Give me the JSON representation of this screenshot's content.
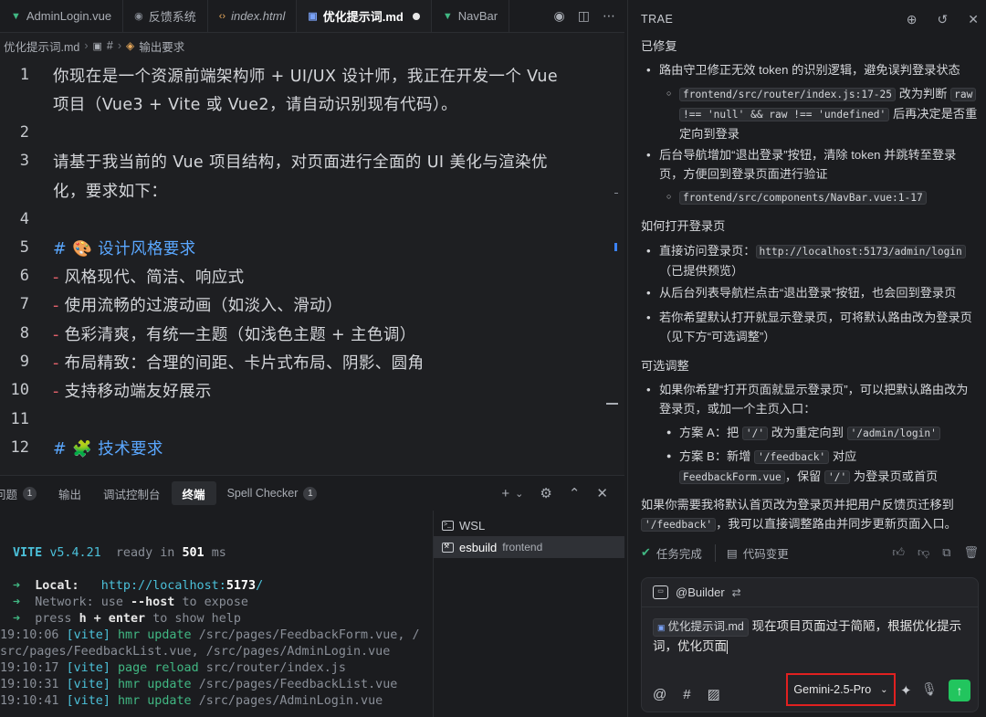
{
  "tabs": [
    {
      "label": "AdminLogin.vue",
      "icon": "vue-icon"
    },
    {
      "label": "反馈系统",
      "icon": "eye-icon"
    },
    {
      "label": "index.html",
      "icon": "html-icon"
    },
    {
      "label": "优化提示词.md",
      "icon": "markdown-icon",
      "active": true,
      "modified": true
    },
    {
      "label": "NavBar",
      "icon": "vue-icon"
    }
  ],
  "breadcrumb": [
    "优化提示词.md",
    "#",
    "输出要求"
  ],
  "editor": {
    "lines": [
      {
        "n": "1",
        "text": "你现在是一个资源前端架构师 + UI/UX 设计师，我正在开发一个 Vue"
      },
      {
        "n": "",
        "text": "项目（Vue3 + Vite 或 Vue2，请自动识别现有代码）。"
      },
      {
        "n": "2",
        "text": ""
      },
      {
        "n": "3",
        "text": "请基于我当前的 Vue 项目结构，对页面进行全面的 UI 美化与渲染优"
      },
      {
        "n": "",
        "text": "化，要求如下："
      },
      {
        "n": "4",
        "text": ""
      },
      {
        "n": "5",
        "text": "# 🎨 设计风格要求"
      },
      {
        "n": "6",
        "text": "- 风格现代、简洁、响应式"
      },
      {
        "n": "7",
        "text": "- 使用流畅的过渡动画（如淡入、滑动）"
      },
      {
        "n": "8",
        "text": "- 色彩清爽，有统一主题（如浅色主题 + 主色调）"
      },
      {
        "n": "9",
        "text": "- 布局精致：合理的间距、卡片式布局、阴影、圆角"
      },
      {
        "n": "10",
        "text": "- 支持移动端友好展示"
      },
      {
        "n": "11",
        "text": ""
      },
      {
        "n": "12",
        "text": "# 🧩 技术要求"
      }
    ]
  },
  "panel": {
    "tabs": [
      {
        "label": "问题",
        "badge": "1"
      },
      {
        "label": "输出"
      },
      {
        "label": "调试控制台"
      },
      {
        "label": "终端",
        "active": true
      },
      {
        "label": "Spell Checker",
        "badge": "1"
      }
    ],
    "terminal_lines": [
      "VITE v5.4.21  ready in 501 ms",
      "➜  Local:   http://localhost:5173/",
      "➜  Network: use --host to expose",
      "➜  press h + enter to show help",
      "19:10:06 [vite] hmr update /src/pages/FeedbackForm.vue, /",
      "src/pages/FeedbackList.vue, /src/pages/AdminLogin.vue",
      "19:10:17 [vite] page reload src/router/index.js",
      "19:10:31 [vite] hmr update /src/pages/FeedbackList.vue",
      "19:10:41 [vite] hmr update /src/pages/AdminLogin.vue"
    ],
    "terminal_parts": {
      "vite": "VITE",
      "version": "v5.4.21",
      "ready": "ready in",
      "ms_val": "501",
      "ms": "ms",
      "arrow": "➜",
      "local_label": "Local:",
      "local_url_a": "http://localhost:",
      "local_port": "5173",
      "local_url_b": "/",
      "network_label": "Network:",
      "network_text_a": "use",
      "network_text_b": "--host",
      "network_text_c": "to expose",
      "press_a": "press",
      "press_b": "h + enter",
      "press_c": "to show help",
      "t1": "19:10:06",
      "t2": "19:10:17",
      "t3": "19:10:31",
      "t4": "19:10:41",
      "tag": "[vite]",
      "hmr": "hmr update",
      "reload": "page reload",
      "path1": "/src/pages/FeedbackForm.vue, /",
      "path1b": "src/pages/FeedbackList.vue, /src/pages/AdminLogin.vue",
      "path2": "src/router/index.js",
      "path3": "/src/pages/FeedbackList.vue",
      "path4": "/src/pages/AdminLogin.vue"
    },
    "terminals": [
      {
        "label": "WSL",
        "sub": ""
      },
      {
        "label": "esbuild",
        "sub": "frontend",
        "active": true
      }
    ]
  },
  "chat": {
    "header_title": "TRAE",
    "sec_fixed": "已修复",
    "fix1": "路由守卫修正无效 token 的识别逻辑，避免误判登录状态",
    "fix1_code1": "frontend/src/router/index.js:17-25",
    "fix1_t1": "改为判断",
    "fix1_code2": "raw",
    "fix1_code3": "!== 'null' && raw !== 'undefined'",
    "fix1_t2": "后再决定是否重定向到登录",
    "fix2": "后台导航增加“退出登录”按钮，清除 token 并跳转至登录页，方便回到登录页面进行验证",
    "fix2_code": "frontend/src/components/NavBar.vue:1-17",
    "sec_open": "如何打开登录页",
    "open1_t": "直接访问登录页：",
    "open1_code": "http://localhost:5173/admin/login",
    "open1_t2": "（已提供预览）",
    "open2": "从后台列表导航栏点击“退出登录”按钮，也会回到登录页",
    "open3": "若你希望默认打开就显示登录页，可将默认路由改为登录页（见下方“可选调整”）",
    "sec_opt": "可选调整",
    "opt1": "如果你希望“打开页面就显示登录页”，可以把默认路由改为登录页，或加一个主页入口：",
    "optA_t1": "方案 A：把",
    "optA_c1": "'/'",
    "optA_t2": "改为重定向到",
    "optA_c2": "'/admin/login'",
    "optB_t1": "方案 B：新增",
    "optB_c1": "'/feedback'",
    "optB_t2": "对应",
    "optB_c2": "FeedbackForm.vue",
    "optB_t3": "，保留",
    "optB_c3": "'/'",
    "optB_t4": "为登录页或首页",
    "closing_t1": "如果你需要我将默认首页改为登录页并把用户反馈页迁移到",
    "closing_code": "'/feedback'",
    "closing_t2": "，我可以直接调整路由并同步更新页面入口。",
    "status_done": "任务完成",
    "status_diff": "代码变更"
  },
  "composer": {
    "agent": "@Builder",
    "file_chip": "优化提示词.md",
    "prompt": "现在项目页面过于简陋，根据优化提示词，优化页面",
    "model": "Gemini-2.5-Pro"
  },
  "colors": {
    "accent": "#3b82f6",
    "send": "#22c55e",
    "highlight_box": "#e02020",
    "heading": "#5aa7ff",
    "dash": "#e0606a"
  }
}
